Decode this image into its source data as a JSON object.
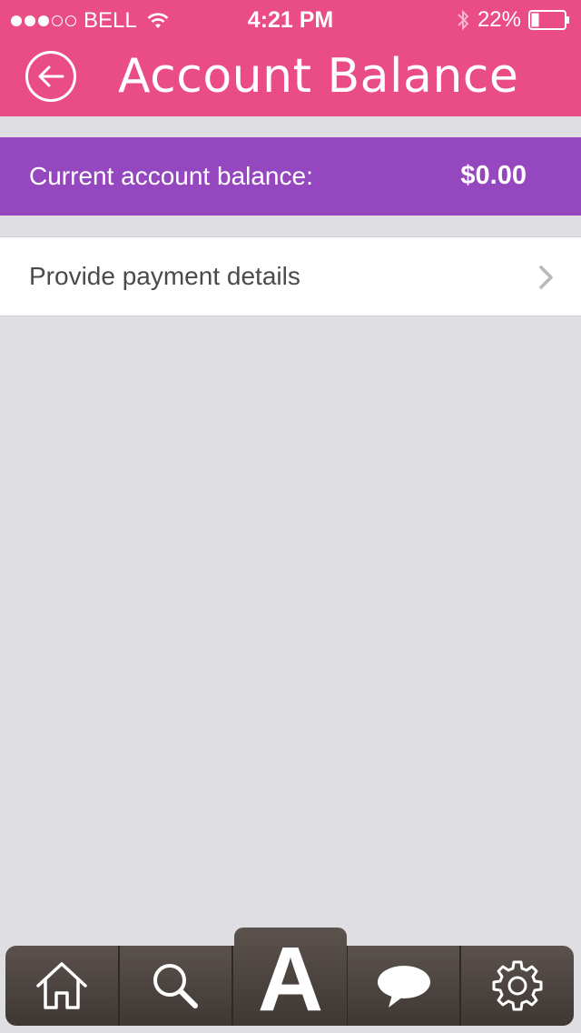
{
  "status_bar": {
    "carrier": "BELL",
    "time": "4:21 PM",
    "battery_percent": "22%",
    "signal_full": 3,
    "signal_empty": 2
  },
  "nav": {
    "title": "Account Balance",
    "back_icon": "back-arrow-icon"
  },
  "balance": {
    "label": "Current account balance:",
    "value": "$0.00"
  },
  "payment": {
    "label": "Provide payment details"
  },
  "tab_bar": {
    "tabs": [
      {
        "icon": "home-icon"
      },
      {
        "icon": "search-icon"
      },
      {
        "icon": "app-logo",
        "letter": "A"
      },
      {
        "icon": "chat-bubble-icon"
      },
      {
        "icon": "gear-icon"
      }
    ]
  },
  "colors": {
    "header": "#ea4c85",
    "banner": "#9547c0",
    "background": "#dfdfe3",
    "tab_bar": "#4a423e"
  }
}
